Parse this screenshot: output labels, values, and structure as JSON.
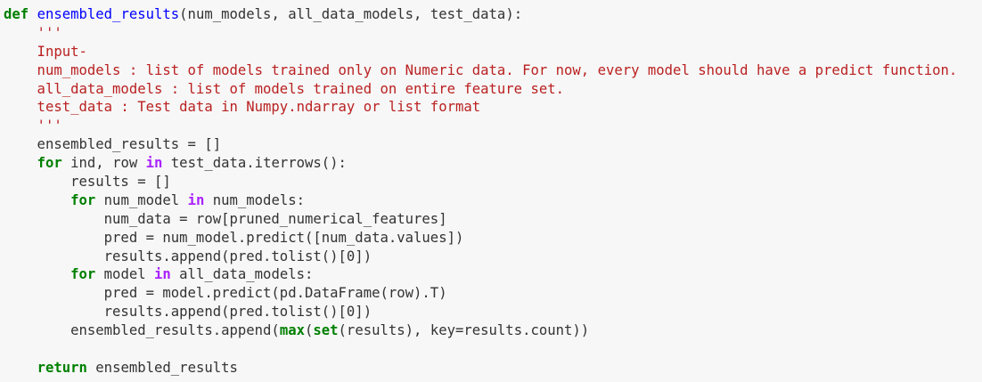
{
  "colors": {
    "background": "#f7f7f7",
    "keyword": "#008000",
    "function_name": "#0000ff",
    "string": "#ba2121",
    "operator_keyword": "#aa22ff",
    "text": "#333333"
  },
  "lines": [
    [
      {
        "t": "def",
        "c": "kw"
      },
      {
        "t": " ",
        "c": "plain"
      },
      {
        "t": "ensembled_results",
        "c": "fn"
      },
      {
        "t": "(num_models, all_data_models, test_data):",
        "c": "plain"
      }
    ],
    [
      {
        "t": "    '''",
        "c": "str"
      }
    ],
    [
      {
        "t": "    Input-",
        "c": "str"
      }
    ],
    [
      {
        "t": "    num_models : list of models trained only on Numeric data. For now, every model should have a predict function.",
        "c": "str"
      }
    ],
    [
      {
        "t": "    all_data_models : list of models trained on entire feature set.",
        "c": "str"
      }
    ],
    [
      {
        "t": "    test_data : Test data in Numpy.ndarray or list format",
        "c": "str"
      }
    ],
    [
      {
        "t": "    '''",
        "c": "str"
      }
    ],
    [
      {
        "t": "    ensembled_results = []",
        "c": "plain"
      }
    ],
    [
      {
        "t": "    ",
        "c": "plain"
      },
      {
        "t": "for",
        "c": "kw"
      },
      {
        "t": " ind, row ",
        "c": "plain"
      },
      {
        "t": "in",
        "c": "op"
      },
      {
        "t": " test_data.iterrows():",
        "c": "plain"
      }
    ],
    [
      {
        "t": "        results = []",
        "c": "plain"
      }
    ],
    [
      {
        "t": "        ",
        "c": "plain"
      },
      {
        "t": "for",
        "c": "kw"
      },
      {
        "t": " num_model ",
        "c": "plain"
      },
      {
        "t": "in",
        "c": "op"
      },
      {
        "t": " num_models:",
        "c": "plain"
      }
    ],
    [
      {
        "t": "            num_data = row[pruned_numerical_features]",
        "c": "plain"
      }
    ],
    [
      {
        "t": "            pred = num_model.predict([num_data.values])",
        "c": "plain"
      }
    ],
    [
      {
        "t": "            results.append(pred.tolist()[0])",
        "c": "plain"
      }
    ],
    [
      {
        "t": "        ",
        "c": "plain"
      },
      {
        "t": "for",
        "c": "kw"
      },
      {
        "t": " model ",
        "c": "plain"
      },
      {
        "t": "in",
        "c": "op"
      },
      {
        "t": " all_data_models:",
        "c": "plain"
      }
    ],
    [
      {
        "t": "            pred = model.predict(pd.DataFrame(row).T)",
        "c": "plain"
      }
    ],
    [
      {
        "t": "            results.append(pred.tolist()[0])",
        "c": "plain"
      }
    ],
    [
      {
        "t": "        ensembled_results.append(",
        "c": "plain"
      },
      {
        "t": "max",
        "c": "kw2"
      },
      {
        "t": "(",
        "c": "plain"
      },
      {
        "t": "set",
        "c": "kw2"
      },
      {
        "t": "(results), key=results.count))",
        "c": "plain"
      }
    ],
    [
      {
        "t": "",
        "c": "plain"
      }
    ],
    [
      {
        "t": "    ",
        "c": "plain"
      },
      {
        "t": "return",
        "c": "kw"
      },
      {
        "t": " ensembled_results",
        "c": "plain"
      }
    ]
  ]
}
